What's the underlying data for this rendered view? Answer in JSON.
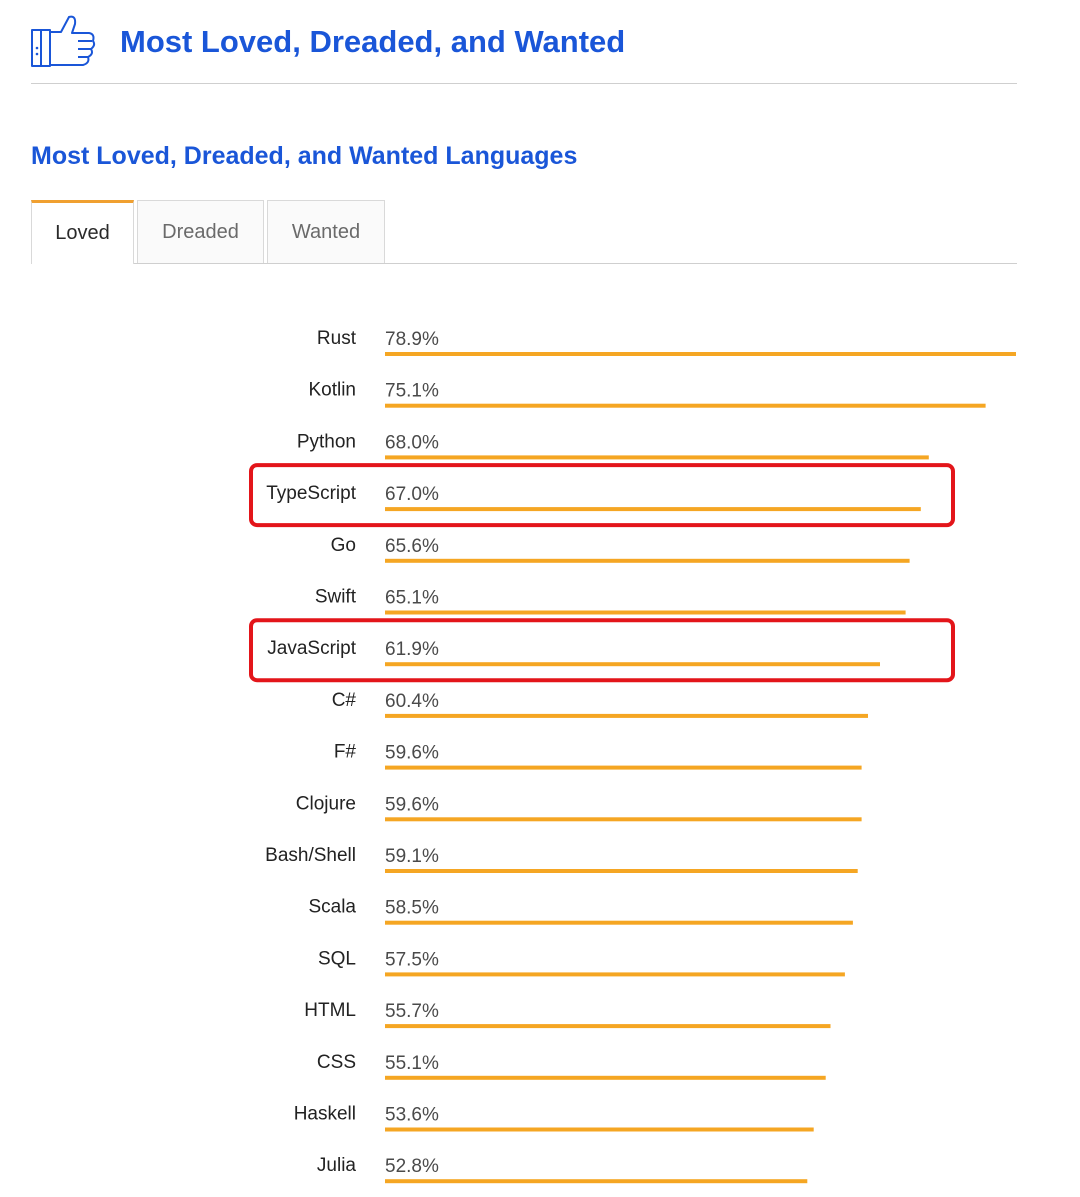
{
  "header": {
    "title": "Most Loved, Dreaded, and Wanted",
    "icon": "thumbs-up-icon"
  },
  "section": {
    "title": "Most Loved, Dreaded, and Wanted Languages"
  },
  "tabs": [
    {
      "label": "Loved",
      "active": true
    },
    {
      "label": "Dreaded",
      "active": false
    },
    {
      "label": "Wanted",
      "active": false
    }
  ],
  "colors": {
    "accent": "#1a56d8",
    "bar": "#f5a623",
    "highlight": "#e3151a",
    "tab_active": "#f0a030"
  },
  "chart_data": {
    "type": "bar",
    "orientation": "horizontal",
    "categories": [
      "Rust",
      "Kotlin",
      "Python",
      "TypeScript",
      "Go",
      "Swift",
      "JavaScript",
      "C#",
      "F#",
      "Clojure",
      "Bash/Shell",
      "Scala",
      "SQL",
      "HTML",
      "CSS",
      "Haskell",
      "Julia"
    ],
    "values": [
      78.9,
      75.1,
      68.0,
      67.0,
      65.6,
      65.1,
      61.9,
      60.4,
      59.6,
      59.6,
      59.1,
      58.5,
      57.5,
      55.7,
      55.1,
      53.6,
      52.8
    ],
    "value_labels": [
      "78.9%",
      "75.1%",
      "68.0%",
      "67.0%",
      "65.6%",
      "65.1%",
      "61.9%",
      "60.4%",
      "59.6%",
      "59.6%",
      "59.1%",
      "58.5%",
      "57.5%",
      "55.7%",
      "55.1%",
      "53.6%",
      "52.8%"
    ],
    "unit": "%",
    "highlighted": [
      "TypeScript",
      "JavaScript"
    ]
  }
}
